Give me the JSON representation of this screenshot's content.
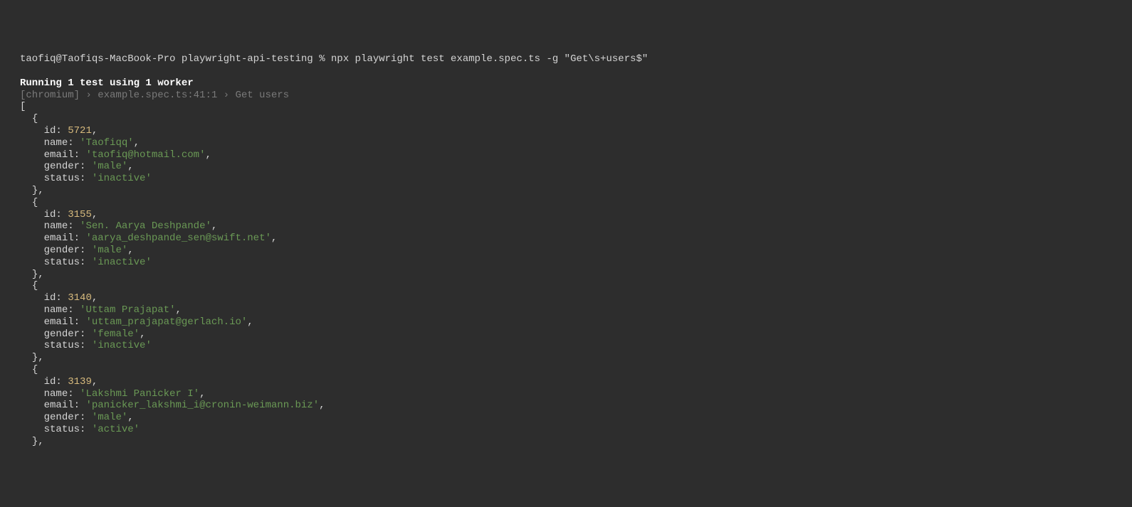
{
  "prompt": {
    "user": "taofiq@Taofiqs-MacBook-Pro",
    "directory": "playwright-api-testing",
    "symbol": "%",
    "command": "npx playwright test example.spec.ts -g \"Get\\s+users$\""
  },
  "header": {
    "running": "Running 1 test using 1 worker",
    "spec_line": "[chromium] › example.spec.ts:41:1 › Get users"
  },
  "users": [
    {
      "id": 5721,
      "name": "Taofiqq",
      "email": "taofiq@hotmail.com",
      "gender": "male",
      "status": "inactive"
    },
    {
      "id": 3155,
      "name": "Sen. Aarya Deshpande",
      "email": "aarya_deshpande_sen@swift.net",
      "gender": "male",
      "status": "inactive"
    },
    {
      "id": 3140,
      "name": "Uttam Prajapat",
      "email": "uttam_prajapat@gerlach.io",
      "gender": "female",
      "status": "inactive"
    },
    {
      "id": 3139,
      "name": "Lakshmi Panicker I",
      "email": "panicker_lakshmi_i@cronin-weimann.biz",
      "gender": "male",
      "status": "active"
    }
  ],
  "labels": {
    "id": "id:",
    "name": "name:",
    "email": "email:",
    "gender": "gender:",
    "status": "status:"
  }
}
